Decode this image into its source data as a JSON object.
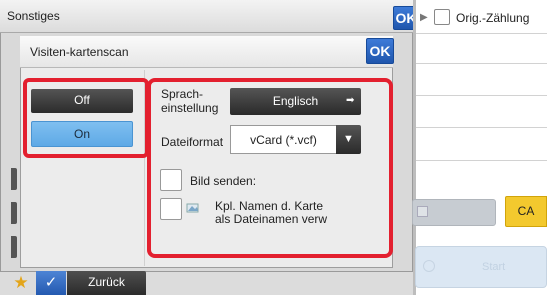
{
  "back_panel": {
    "title": "Sonstiges",
    "ok_label": "OK"
  },
  "dialog": {
    "title": "Visiten-kartenscan",
    "ok_label": "OK",
    "off_label": "Off",
    "on_label": "On",
    "selected": "On",
    "language_label": "Sprach-\neinstellung",
    "language_value": "Englisch",
    "format_label": "Dateiformat",
    "format_value": "vCard (*.vcf)",
    "send_image_label": "Bild senden:",
    "card_name_label": "Kpl. Namen d. Karte\nals Dateinamen verw"
  },
  "right_panel": {
    "orig_count_label": "Orig.-Zählung",
    "ca_label": "CA",
    "start_label": "Start"
  },
  "bottom_bar": {
    "back_label": "Zurück"
  },
  "colors": {
    "highlight_red": "#e3202f",
    "selected_blue": "#6db4ec",
    "ca_yellow": "#f3c92e",
    "ok_blue": "#2a63bd"
  },
  "icons": [
    "play-icon",
    "star-icon",
    "checkmark-icon",
    "arrow-right-icon",
    "dropdown-triangle-icon",
    "card-image-icon",
    "start-icon"
  ]
}
